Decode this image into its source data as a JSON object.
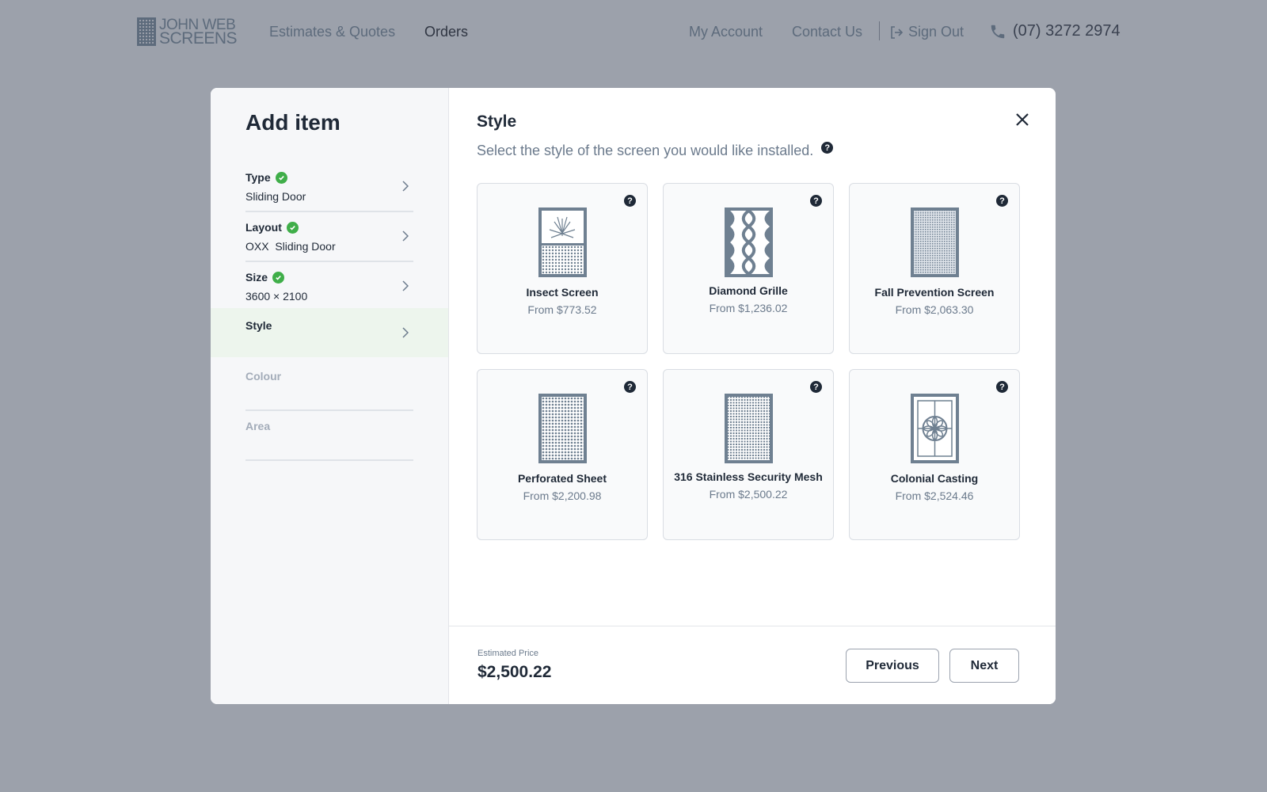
{
  "nav": {
    "logo_line1": "JOHN WEB",
    "logo_line2": "SCREENS",
    "links": [
      "Estimates & Quotes",
      "Orders"
    ],
    "my_account": "My Account",
    "contact_us": "Contact Us",
    "sign_out": "Sign Out",
    "phone": "(07) 3272 2974"
  },
  "modal": {
    "title": "Add item",
    "steps": [
      {
        "label": "Type",
        "value": "Sliding Door",
        "state": "complete"
      },
      {
        "label": "Layout",
        "value": "OXX  Sliding Door",
        "state": "complete"
      },
      {
        "label": "Size",
        "value": "3600 × 2100",
        "state": "complete"
      },
      {
        "label": "Style",
        "value": "",
        "state": "active"
      },
      {
        "label": "Colour",
        "value": "",
        "state": "disabled"
      },
      {
        "label": "Area",
        "value": "",
        "state": "disabled"
      }
    ],
    "section_title": "Style",
    "section_subtitle": "Select the style of the screen you would like installed.",
    "help_glyph": "?",
    "options": [
      {
        "name": "Insect Screen",
        "price": "From $773.52",
        "icon": "insect-screen-icon"
      },
      {
        "name": "Diamond Grille",
        "price": "From $1,236.02",
        "icon": "diamond-grille-icon"
      },
      {
        "name": "Fall Prevention Screen",
        "price": "From $2,063.30",
        "icon": "fall-prevention-icon"
      },
      {
        "name": "Perforated Sheet",
        "price": "From $2,200.98",
        "icon": "perforated-sheet-icon"
      },
      {
        "name": "316 Stainless Security Mesh",
        "price": "From $2,500.22",
        "icon": "security-mesh-icon"
      },
      {
        "name": "Colonial Casting",
        "price": "From $2,524.46",
        "icon": "colonial-casting-icon"
      }
    ],
    "estimated_label": "Estimated Price",
    "estimated_value": "$2,500.22",
    "previous_label": "Previous",
    "next_label": "Next"
  },
  "colors": {
    "backdrop": "#9ca1ab",
    "accent_green": "#3fae49",
    "icon_slate": "#6f8091"
  }
}
